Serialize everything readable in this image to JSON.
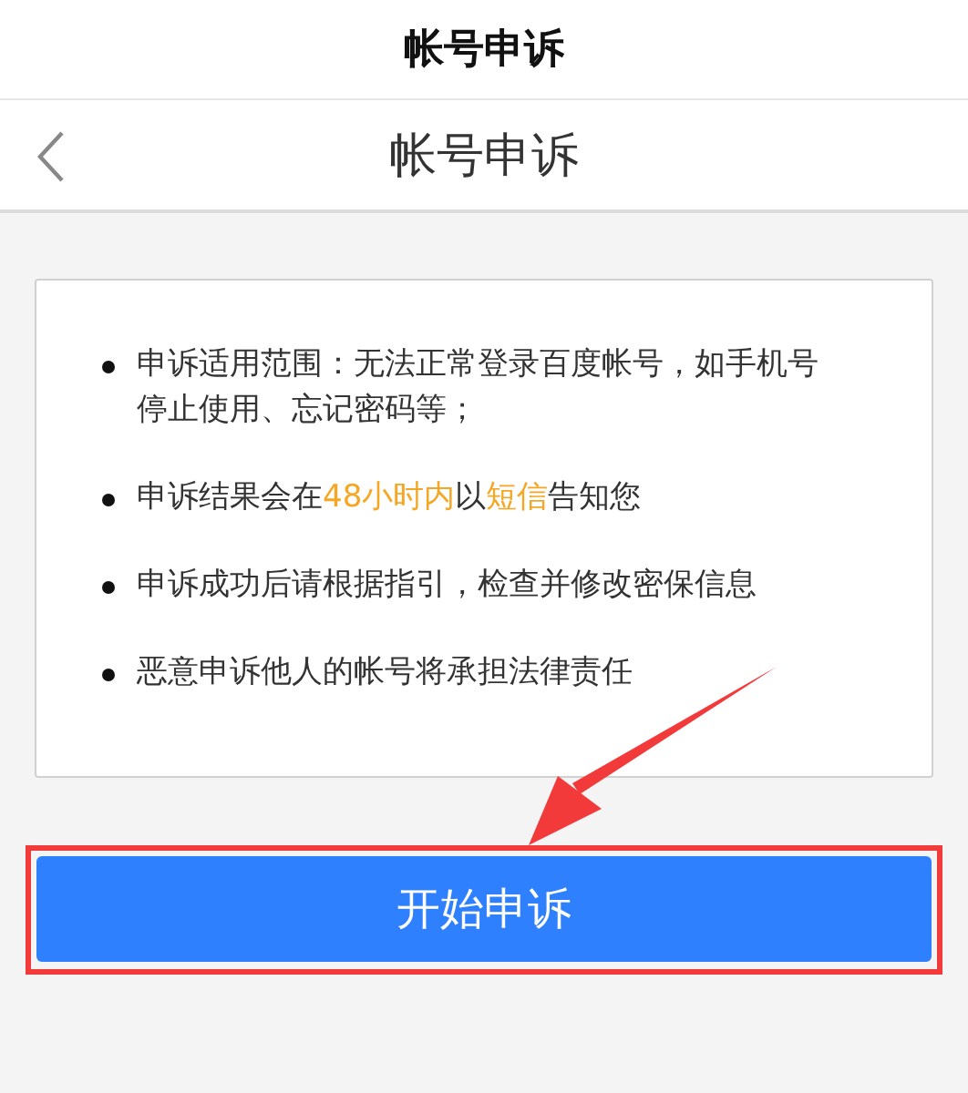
{
  "status_title": "帐号申诉",
  "nav": {
    "title": "帐号申诉"
  },
  "notices": [
    {
      "parts": [
        {
          "text": "申诉适用范围：无法正常登录百度帐号，如手机号停止使用、忘记密码等；",
          "highlight": false
        }
      ]
    },
    {
      "parts": [
        {
          "text": "申诉结果会在",
          "highlight": false
        },
        {
          "text": "48小时内",
          "highlight": true
        },
        {
          "text": "以",
          "highlight": false
        },
        {
          "text": "短信",
          "highlight": true
        },
        {
          "text": "告知您",
          "highlight": false
        }
      ]
    },
    {
      "parts": [
        {
          "text": "申诉成功后请根据指引，检查并修改密保信息",
          "highlight": false
        }
      ]
    },
    {
      "parts": [
        {
          "text": "恶意申诉他人的帐号将承担法律责任",
          "highlight": false
        }
      ]
    }
  ],
  "start_button": "开始申诉"
}
